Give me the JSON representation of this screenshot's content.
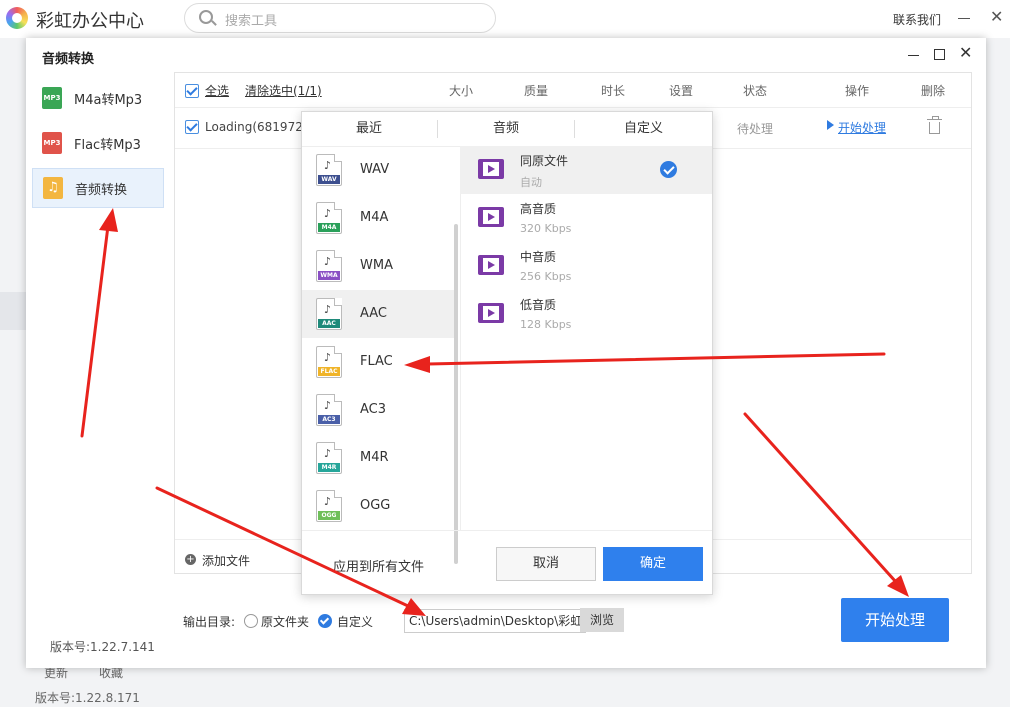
{
  "app": {
    "title": "彩虹办公中心",
    "search_placeholder": "搜索工具",
    "contact": "联系我们",
    "footer_update": "更新",
    "footer_favorite": "收藏",
    "version": "版本号:1.22.8.171"
  },
  "dialog": {
    "title": "音频转换",
    "version": "版本号:1.22.7.141",
    "sidebar": [
      {
        "label": "M4a转Mp3",
        "icon": "m4a-file-icon",
        "badge": "MP3"
      },
      {
        "label": "Flac转Mp3",
        "icon": "flac-file-icon",
        "badge": "MP3"
      },
      {
        "label": "音频转换",
        "icon": "music-note-icon",
        "badge": "♫"
      }
    ],
    "table_header": {
      "select_all": "全选",
      "clear_selected": "清除选中(1/1)",
      "size": "大小",
      "quality": "质量",
      "duration": "时长",
      "settings": "设置",
      "status": "状态",
      "action": "操作",
      "delete": "删除"
    },
    "row": {
      "name": "Loading(6819724",
      "status": "待处理",
      "action": "开始处理"
    },
    "add_file": "添加文件",
    "output_dir_label": "输出目录:",
    "radio_original": "原文件夹",
    "radio_custom": "自定义",
    "path": "C:\\Users\\admin\\Desktop\\彩虹",
    "browse": "浏览",
    "start_button": "开始处理"
  },
  "popup": {
    "tabs": [
      "最近",
      "音频",
      "自定义"
    ],
    "formats": [
      {
        "name": "WAV",
        "band": "WAV",
        "color": "#3d4f8f"
      },
      {
        "name": "M4A",
        "band": "M4A",
        "color": "#2aa05a"
      },
      {
        "name": "WMA",
        "band": "WMA",
        "color": "#8a4fc4"
      },
      {
        "name": "AAC",
        "band": "AAC",
        "color": "#1f8a7a"
      },
      {
        "name": "FLAC",
        "band": "FLAC",
        "color": "#f0b429"
      },
      {
        "name": "AC3",
        "band": "AC3",
        "color": "#4a5fa8"
      },
      {
        "name": "M4R",
        "band": "M4R",
        "color": "#26a69a"
      },
      {
        "name": "OGG",
        "band": "OGG",
        "color": "#6fbf5a"
      }
    ],
    "qualities": [
      {
        "name": "同原文件",
        "sub": "自动"
      },
      {
        "name": "高音质",
        "sub": "320 Kbps"
      },
      {
        "name": "中音质",
        "sub": "256 Kbps"
      },
      {
        "name": "低音质",
        "sub": "128 Kbps"
      }
    ],
    "apply_all": "应用到所有文件",
    "cancel": "取消",
    "ok": "确定"
  },
  "colors": {
    "accent": "#2f80ed",
    "annotation_arrow": "#e8231d"
  }
}
